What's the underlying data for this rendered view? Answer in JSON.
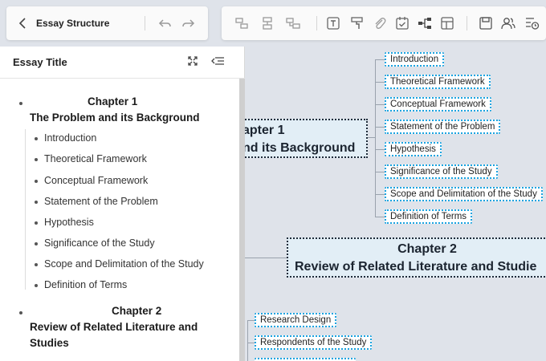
{
  "header": {
    "back_icon": "chevron-left-icon",
    "title": "Essay Structure"
  },
  "toolbar": {
    "icons": [
      "undo-icon",
      "redo-icon",
      "insert-topic-icon",
      "insert-subtopic-icon",
      "insert-floating-icon",
      "text-box-icon",
      "format-painter-icon",
      "attachment-icon",
      "task-icon",
      "structure-icon",
      "layout-icon",
      "save-icon",
      "collaborators-icon",
      "outline-view-icon"
    ]
  },
  "outline": {
    "title": "Essay Title",
    "chapters": [
      {
        "line1": "Chapter 1",
        "line2": "The Problem and its Background",
        "items": [
          "Introduction",
          "Theoretical Framework",
          "Conceptual Framework",
          "Statement of the Problem",
          "Hypothesis",
          "Significance of the Study",
          "Scope and Delimitation of the Study",
          "Definition of Terms"
        ]
      },
      {
        "line1": "Chapter 2",
        "line2": "Review of Related Literature and",
        "line3": "Studies"
      }
    ]
  },
  "canvas": {
    "topic1": {
      "line1": "apter 1",
      "line2": "nd its Background"
    },
    "topic2": {
      "line1": "Chapter 2",
      "line2": "Review of Related Literature and Studie"
    },
    "subtopics1": [
      "Introduction",
      "Theoretical Framework",
      "Conceptual Framework",
      "Statement of the Problem",
      "Hypothesis",
      "Significance of the Study",
      "Scope and Delimitation of the Study",
      "Definition of Terms"
    ],
    "subtopics3": [
      "Research Design",
      "Respondents of the Study"
    ]
  },
  "colors": {
    "canvas_bg": "#dfe3ea",
    "topic_bg": "#e2eef6",
    "subtopic_border": "#1aa3e0"
  }
}
